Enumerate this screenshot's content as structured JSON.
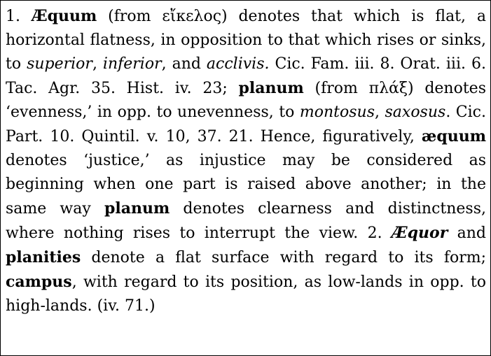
{
  "entry": {
    "segments": [
      {
        "text": "1. ",
        "style": "normal"
      },
      {
        "text": "Æquum",
        "style": "bold"
      },
      {
        "text": " (from εἴκελος) denotes that which is flat, a horizontal flatness, in opposition to that which rises or sinks, to ",
        "style": "normal"
      },
      {
        "text": "superior",
        "style": "italic"
      },
      {
        "text": ", ",
        "style": "normal"
      },
      {
        "text": "inferior",
        "style": "italic"
      },
      {
        "text": ", and ",
        "style": "normal"
      },
      {
        "text": "acclivis.",
        "style": "italic"
      },
      {
        "text": " Cic. Fam. iii. 8. Orat. iii. 6. Tac. Agr. 35. Hist. iv. 23; ",
        "style": "normal"
      },
      {
        "text": "planum",
        "style": "bold"
      },
      {
        "text": " (from πλάξ) denotes ‘evenness,’ in opp. to unevenness, to ",
        "style": "normal"
      },
      {
        "text": "montosus",
        "style": "italic"
      },
      {
        "text": ", ",
        "style": "normal"
      },
      {
        "text": "saxosus",
        "style": "italic"
      },
      {
        "text": ". Cic. Part. 10. Quintil. v. 10, 37. 21. Hence, figuratively, ",
        "style": "normal"
      },
      {
        "text": "æquum",
        "style": "bold"
      },
      {
        "text": " denotes ‘justice,’ as injustice may be considered as beginning when one part is raised above another; in the same way ",
        "style": "normal"
      },
      {
        "text": "planum",
        "style": "bold"
      },
      {
        "text": " denotes clearness and distinctness, where nothing rises to interrupt the view. 2. ",
        "style": "normal"
      },
      {
        "text": "Æquor",
        "style": "bold-italic"
      },
      {
        "text": " and ",
        "style": "normal"
      },
      {
        "text": "planities",
        "style": "bold"
      },
      {
        "text": " denote a flat surface with regard to its form; ",
        "style": "normal"
      },
      {
        "text": "campus",
        "style": "bold"
      },
      {
        "text": ", with regard to its position, as low-lands in opp. to high-lands. (iv. 71.)",
        "style": "normal"
      }
    ]
  }
}
